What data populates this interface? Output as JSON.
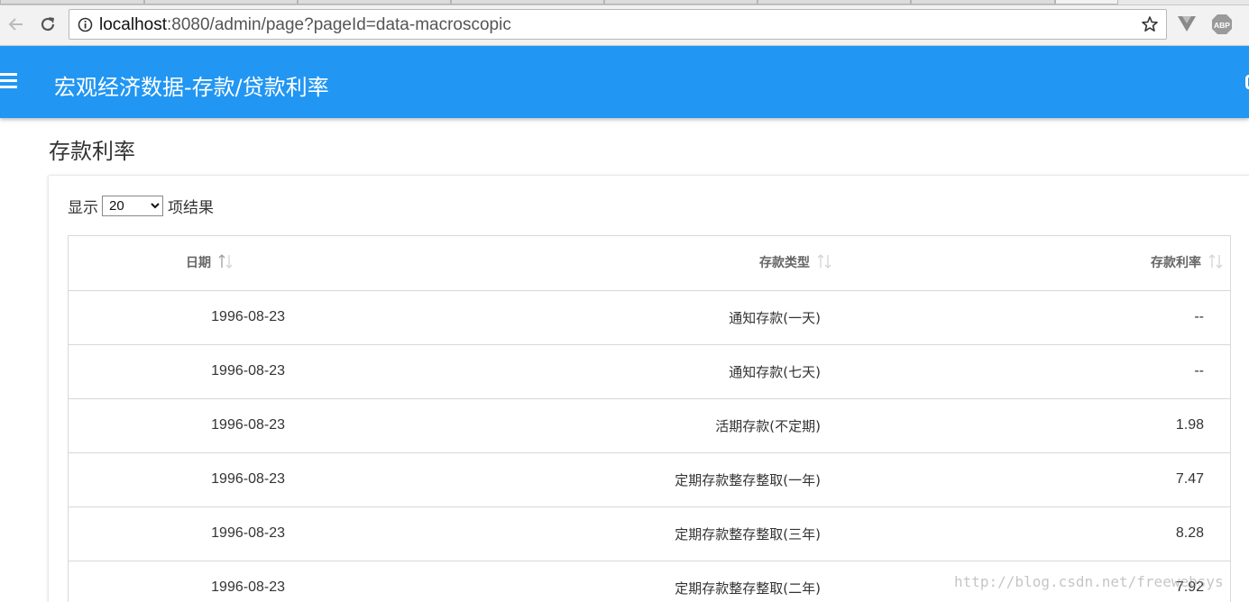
{
  "browser": {
    "url_host": "localhost",
    "url_rest": ":8080/admin/page?pageId=data-macroscopic",
    "icons": [
      "back-arrow-icon",
      "reload-icon",
      "info-icon",
      "star-icon",
      "vuejs-extension-icon",
      "adblock-extension-icon"
    ],
    "adblock_label": "ABP"
  },
  "header": {
    "title": "宏观经济数据-存款/贷款利率",
    "accent_color": "#2196f3"
  },
  "page": {
    "section_title": "存款利率",
    "length_prefix": "显示",
    "length_value": "20",
    "length_suffix": "项结果"
  },
  "table": {
    "columns": [
      "日期",
      "存款类型",
      "存款利率"
    ],
    "rows": [
      [
        "1996-08-23",
        "通知存款(一天)",
        "--"
      ],
      [
        "1996-08-23",
        "通知存款(七天)",
        "--"
      ],
      [
        "1996-08-23",
        "活期存款(不定期)",
        "1.98"
      ],
      [
        "1996-08-23",
        "定期存款整存整取(一年)",
        "7.47"
      ],
      [
        "1996-08-23",
        "定期存款整存整取(三年)",
        "8.28"
      ],
      [
        "1996-08-23",
        "定期存款整存整取(二年)",
        "7.92"
      ]
    ]
  },
  "watermark": "http://blog.csdn.net/freewebsys"
}
